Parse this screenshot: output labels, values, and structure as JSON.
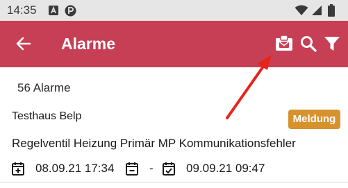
{
  "status_bar": {
    "time": "14:35",
    "icons": [
      "a-box-icon",
      "p-circle-icon",
      "wifi-icon",
      "signal-icon",
      "battery-icon"
    ]
  },
  "app_bar": {
    "title": "Alarme",
    "background": "#c63f55",
    "actions": [
      "back-arrow-icon",
      "clipboard-envelope-icon",
      "search-icon",
      "filter-icon"
    ]
  },
  "list": {
    "count_label": "56 Alarme",
    "items": [
      {
        "site": "Testhaus Belp",
        "badge": "Meldung",
        "badge_color": "#d7922e",
        "message": "Regelventil Heizung Primär MP Kommunikationsfehler",
        "start": "08.09.21 17:34",
        "separator": "-",
        "end": "09.09.21 09:47"
      }
    ]
  },
  "annotation": {
    "arrow_color": "#e8221c"
  }
}
